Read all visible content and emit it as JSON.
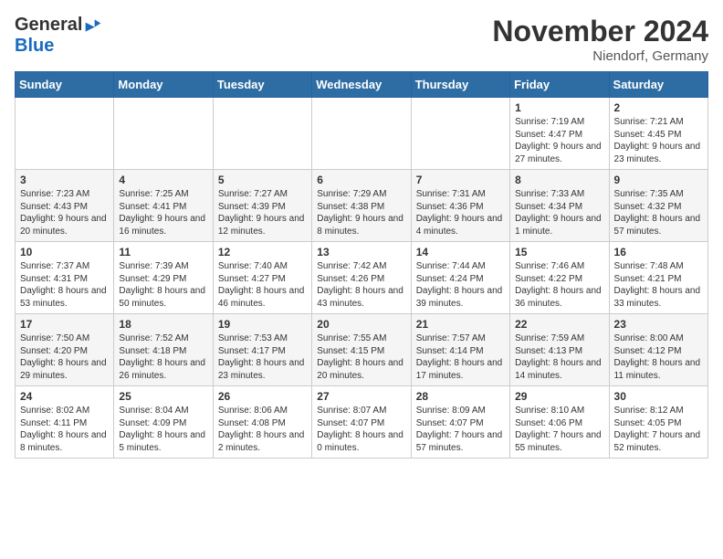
{
  "header": {
    "logo_general": "General",
    "logo_blue": "Blue",
    "month_title": "November 2024",
    "location": "Niendorf, Germany"
  },
  "days_of_week": [
    "Sunday",
    "Monday",
    "Tuesday",
    "Wednesday",
    "Thursday",
    "Friday",
    "Saturday"
  ],
  "weeks": [
    [
      {
        "num": "",
        "info": ""
      },
      {
        "num": "",
        "info": ""
      },
      {
        "num": "",
        "info": ""
      },
      {
        "num": "",
        "info": ""
      },
      {
        "num": "",
        "info": ""
      },
      {
        "num": "1",
        "info": "Sunrise: 7:19 AM\nSunset: 4:47 PM\nDaylight: 9 hours and 27 minutes."
      },
      {
        "num": "2",
        "info": "Sunrise: 7:21 AM\nSunset: 4:45 PM\nDaylight: 9 hours and 23 minutes."
      }
    ],
    [
      {
        "num": "3",
        "info": "Sunrise: 7:23 AM\nSunset: 4:43 PM\nDaylight: 9 hours and 20 minutes."
      },
      {
        "num": "4",
        "info": "Sunrise: 7:25 AM\nSunset: 4:41 PM\nDaylight: 9 hours and 16 minutes."
      },
      {
        "num": "5",
        "info": "Sunrise: 7:27 AM\nSunset: 4:39 PM\nDaylight: 9 hours and 12 minutes."
      },
      {
        "num": "6",
        "info": "Sunrise: 7:29 AM\nSunset: 4:38 PM\nDaylight: 9 hours and 8 minutes."
      },
      {
        "num": "7",
        "info": "Sunrise: 7:31 AM\nSunset: 4:36 PM\nDaylight: 9 hours and 4 minutes."
      },
      {
        "num": "8",
        "info": "Sunrise: 7:33 AM\nSunset: 4:34 PM\nDaylight: 9 hours and 1 minute."
      },
      {
        "num": "9",
        "info": "Sunrise: 7:35 AM\nSunset: 4:32 PM\nDaylight: 8 hours and 57 minutes."
      }
    ],
    [
      {
        "num": "10",
        "info": "Sunrise: 7:37 AM\nSunset: 4:31 PM\nDaylight: 8 hours and 53 minutes."
      },
      {
        "num": "11",
        "info": "Sunrise: 7:39 AM\nSunset: 4:29 PM\nDaylight: 8 hours and 50 minutes."
      },
      {
        "num": "12",
        "info": "Sunrise: 7:40 AM\nSunset: 4:27 PM\nDaylight: 8 hours and 46 minutes."
      },
      {
        "num": "13",
        "info": "Sunrise: 7:42 AM\nSunset: 4:26 PM\nDaylight: 8 hours and 43 minutes."
      },
      {
        "num": "14",
        "info": "Sunrise: 7:44 AM\nSunset: 4:24 PM\nDaylight: 8 hours and 39 minutes."
      },
      {
        "num": "15",
        "info": "Sunrise: 7:46 AM\nSunset: 4:22 PM\nDaylight: 8 hours and 36 minutes."
      },
      {
        "num": "16",
        "info": "Sunrise: 7:48 AM\nSunset: 4:21 PM\nDaylight: 8 hours and 33 minutes."
      }
    ],
    [
      {
        "num": "17",
        "info": "Sunrise: 7:50 AM\nSunset: 4:20 PM\nDaylight: 8 hours and 29 minutes."
      },
      {
        "num": "18",
        "info": "Sunrise: 7:52 AM\nSunset: 4:18 PM\nDaylight: 8 hours and 26 minutes."
      },
      {
        "num": "19",
        "info": "Sunrise: 7:53 AM\nSunset: 4:17 PM\nDaylight: 8 hours and 23 minutes."
      },
      {
        "num": "20",
        "info": "Sunrise: 7:55 AM\nSunset: 4:15 PM\nDaylight: 8 hours and 20 minutes."
      },
      {
        "num": "21",
        "info": "Sunrise: 7:57 AM\nSunset: 4:14 PM\nDaylight: 8 hours and 17 minutes."
      },
      {
        "num": "22",
        "info": "Sunrise: 7:59 AM\nSunset: 4:13 PM\nDaylight: 8 hours and 14 minutes."
      },
      {
        "num": "23",
        "info": "Sunrise: 8:00 AM\nSunset: 4:12 PM\nDaylight: 8 hours and 11 minutes."
      }
    ],
    [
      {
        "num": "24",
        "info": "Sunrise: 8:02 AM\nSunset: 4:11 PM\nDaylight: 8 hours and 8 minutes."
      },
      {
        "num": "25",
        "info": "Sunrise: 8:04 AM\nSunset: 4:09 PM\nDaylight: 8 hours and 5 minutes."
      },
      {
        "num": "26",
        "info": "Sunrise: 8:06 AM\nSunset: 4:08 PM\nDaylight: 8 hours and 2 minutes."
      },
      {
        "num": "27",
        "info": "Sunrise: 8:07 AM\nSunset: 4:07 PM\nDaylight: 8 hours and 0 minutes."
      },
      {
        "num": "28",
        "info": "Sunrise: 8:09 AM\nSunset: 4:07 PM\nDaylight: 7 hours and 57 minutes."
      },
      {
        "num": "29",
        "info": "Sunrise: 8:10 AM\nSunset: 4:06 PM\nDaylight: 7 hours and 55 minutes."
      },
      {
        "num": "30",
        "info": "Sunrise: 8:12 AM\nSunset: 4:05 PM\nDaylight: 7 hours and 52 minutes."
      }
    ]
  ]
}
